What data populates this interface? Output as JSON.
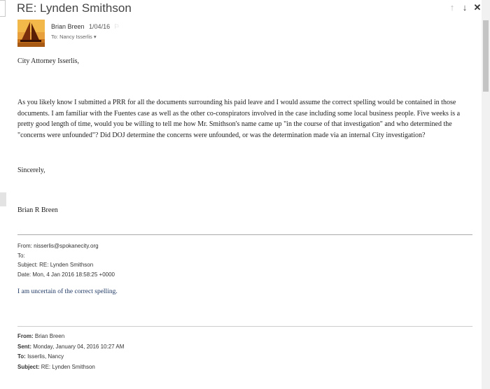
{
  "subject": "RE: Lynden Smithson",
  "header_icons": {
    "up": "↑",
    "down": "↓",
    "close": "✕"
  },
  "sender": {
    "name": "Brian Breen",
    "date": "1/04/16",
    "to_label": "To: Nancy Isserlis",
    "to_chevron": "▾",
    "flag": "⚐"
  },
  "message": {
    "greeting": "City Attorney Isserlis,",
    "body": "As you likely know I submitted a PRR for all the documents surrounding his paid leave and I would assume the correct spelling would be contained in those documents. I am familiar with the Fuentes case as well as the other co-conspirators involved in the case including some local business people. Five weeks is a pretty good length of time, would you be willing to tell me how Mr. Smithson's name came up \"in the course of that investigation\" and who determined the \"concerns were unfounded\"? Did DOJ determine the concerns were unfounded, or was the determination made via an internal City investigation?",
    "closing": "Sincerely,",
    "signature": "Brian R Breen"
  },
  "quoted1": {
    "from": "From: nisserlis@spokanecity.org",
    "to": "To:",
    "subject": "Subject: RE: Lynden Smithson",
    "date": "Date: Mon, 4 Jan 2016 18:58:25 +0000",
    "body": "I am uncertain of the correct spelling."
  },
  "quoted2": {
    "from_label": "From:",
    "from_value": " Brian Breen",
    "sent_label": "Sent:",
    "sent_value": " Monday, January 04, 2016 10:27 AM",
    "to_label": "To:",
    "to_value": " Isserlis, Nancy",
    "subject_label": "Subject:",
    "subject_value": " RE: Lynden Smithson"
  }
}
